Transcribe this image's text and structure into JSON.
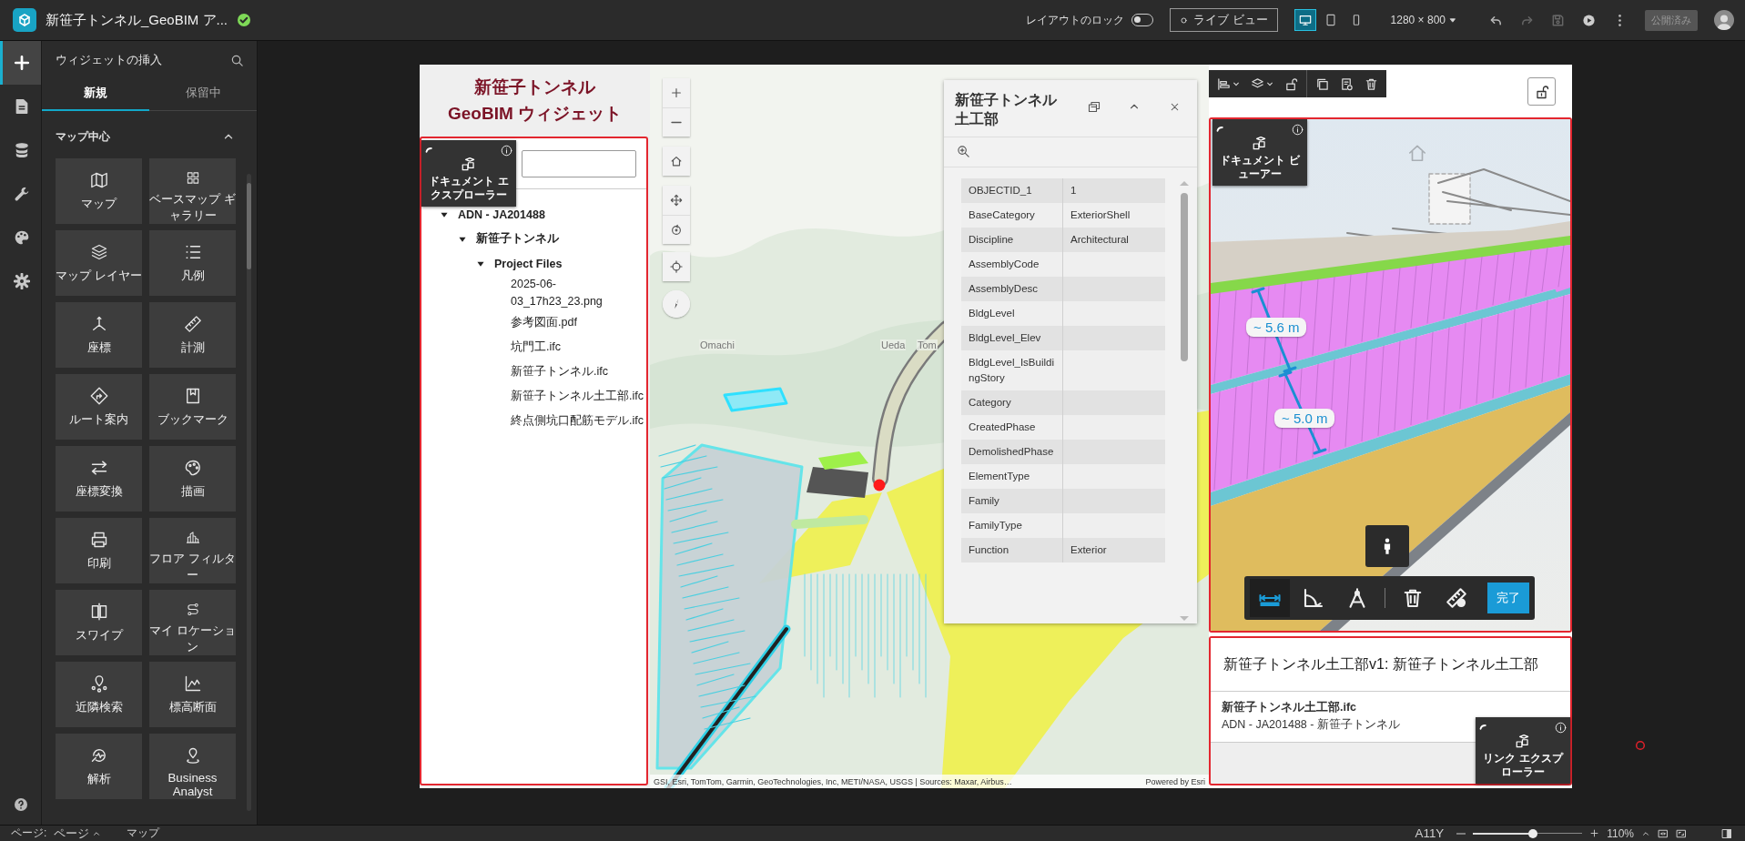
{
  "app_bar": {
    "title": "新笹子トンネル_GeoBIM ア...",
    "layout_lock": {
      "label": "レイアウトのロック",
      "on": false
    },
    "live_view": "ライブ ビュー",
    "devices": [
      {
        "selected": true
      },
      {
        "selected": false
      },
      {
        "selected": false
      }
    ],
    "resolution": "1280 × 800",
    "undo": {
      "disabled": false
    },
    "redo": {
      "disabled": true
    },
    "save": {
      "disabled": true
    },
    "publish": {
      "label": "公開済み",
      "disabled": true
    }
  },
  "rail": [
    {
      "selected": true
    },
    {
      "selected": false
    },
    {
      "selected": false
    },
    {
      "selected": false
    },
    {
      "selected": false
    },
    {
      "selected": false
    }
  ],
  "widget_panel": {
    "title": "ウィジェットの挿入",
    "tabs": [
      {
        "label": "新規",
        "selected": true
      },
      {
        "label": "保留中",
        "selected": false
      }
    ],
    "section": {
      "title": "マップ中心",
      "expanded": true
    },
    "widgets": [
      {
        "label": "マップ"
      },
      {
        "label": "ベースマップ ギャラリー"
      },
      {
        "label": "マップ レイヤー"
      },
      {
        "label": "凡例"
      },
      {
        "label": "座標"
      },
      {
        "label": "計測"
      },
      {
        "label": "ルート案内"
      },
      {
        "label": "ブックマーク"
      },
      {
        "label": "座標変換"
      },
      {
        "label": "描画"
      },
      {
        "label": "印刷"
      },
      {
        "label": "フロア フィルター"
      },
      {
        "label": "スワイプ"
      },
      {
        "label": "マイ ロケーション"
      },
      {
        "label": "近隣検索"
      },
      {
        "label": "標高断面"
      },
      {
        "label": "解析"
      },
      {
        "label": "Business Analyst"
      }
    ]
  },
  "page": {
    "title": [
      "新笹子トンネル",
      "GeoBIM ウィジェット"
    ],
    "document_explorer": {
      "widget_label": "ドキュメント エクスプローラー",
      "tree": [
        {
          "label": "ADN - JA201488",
          "expanded": true,
          "children": [
            {
              "label": "新笹子トンネル",
              "expanded": true,
              "children": [
                {
                  "label": "Project Files",
                  "expanded": true,
                  "children": [
                    {
                      "label": "2025-06-03_17h23_23.png"
                    },
                    {
                      "label": "参考図面.pdf"
                    },
                    {
                      "label": "坑門工.ifc"
                    },
                    {
                      "label": "新笹子トンネル.ifc"
                    },
                    {
                      "label": "新笹子トンネル土工部.ifc"
                    },
                    {
                      "label": "終点側坑口配筋モデル.ifc"
                    }
                  ]
                }
              ]
            }
          ]
        }
      ]
    },
    "map": {
      "labels": [
        "Omachi",
        "Ueda",
        "Tom"
      ],
      "attribution": "GSI, Esri, TomTom, Garmin, GeoTechnologies, Inc, METI/NASA, USGS | Sources: Maxar, Airbus…",
      "powered_by": "Powered by Esri",
      "popup": {
        "title": "新笹子トンネル土工部",
        "fields": [
          {
            "name": "OBJECTID_1",
            "value": "1"
          },
          {
            "name": "BaseCategory",
            "value": "ExteriorShell"
          },
          {
            "name": "Discipline",
            "value": "Architectural"
          },
          {
            "name": "AssemblyCode"
          },
          {
            "name": "AssemblyDesc"
          },
          {
            "name": "BldgLevel"
          },
          {
            "name": "BldgLevel_Elev"
          },
          {
            "name": "BldgLevel_IsBuildingStory"
          },
          {
            "name": "Category"
          },
          {
            "name": "CreatedPhase"
          },
          {
            "name": "DemolishedPhase"
          },
          {
            "name": "ElementType"
          },
          {
            "name": "Family"
          },
          {
            "name": "FamilyType"
          },
          {
            "name": "Function",
            "value": "Exterior"
          }
        ]
      }
    },
    "document_viewer": {
      "widget_label": "ドキュメント ビューアー",
      "measurements": [
        "~ 5.6 m",
        "~ 5.0 m"
      ],
      "tools": [
        {
          "selected": true
        },
        {
          "selected": false
        },
        {
          "selected": false
        },
        {
          "selected": false
        },
        {
          "selected": false
        }
      ],
      "done": "完了"
    },
    "link_explorer": {
      "title": "新笹子トンネル土工部v1: 新笹子トンネル土工部",
      "file": "新笹子トンネル土工部.ifc",
      "path": "ADN - JA201488 - 新笹子トンネル",
      "widget_label": "リンク エクスプローラー"
    }
  },
  "status_bar": {
    "page_label": "ページ:",
    "page": "ページ",
    "view": "マップ",
    "a11y": "A11Y",
    "zoom": {
      "level": 0.55
    },
    "zoom_text": "110%"
  }
}
